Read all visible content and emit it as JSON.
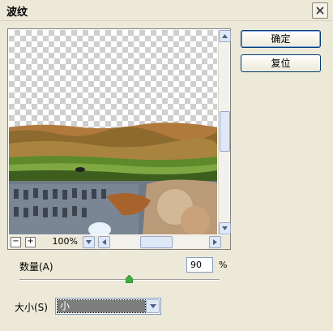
{
  "window": {
    "title": "波纹"
  },
  "buttons": {
    "ok": "确定",
    "reset": "复位"
  },
  "preview": {
    "zoom": "100%",
    "zoom_out": "−",
    "zoom_in": "+"
  },
  "amount": {
    "label": "数量(A)",
    "value": "90",
    "unit": "%",
    "level": 0.55
  },
  "size": {
    "label": "大小(S)",
    "selected": "小"
  },
  "icons": [
    "close-icon",
    "scroll-up-icon",
    "scroll-down-icon",
    "scroll-left-icon",
    "scroll-right-icon",
    "dropdown-icon",
    "slider-thumb-icon"
  ]
}
